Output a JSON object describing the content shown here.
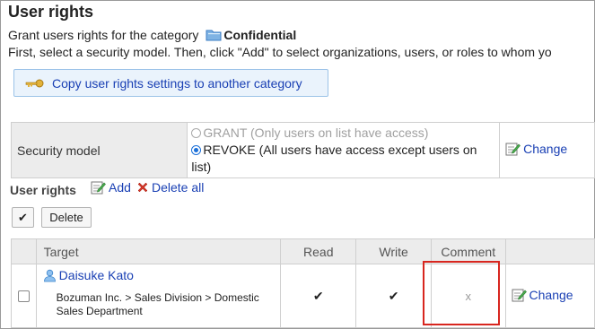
{
  "page": {
    "title": "User rights",
    "grant_prefix": "Grant users rights for the category",
    "category_name": "Confidential",
    "instruction": "First, select a security model. Then, click \"Add\" to select organizations, users, or roles to whom yo"
  },
  "copy_button": {
    "label": "Copy user rights settings to another category"
  },
  "security": {
    "label": "Security model",
    "option_grant": "GRANT (Only users on list have access)",
    "option_revoke": "REVOKE (All users have access except users on list)",
    "selected": "REVOKE",
    "change_label": "Change"
  },
  "rights": {
    "heading": "User rights",
    "add_label": "Add",
    "delete_all_label": "Delete all",
    "check_button": "✔",
    "delete_button": "Delete",
    "columns": [
      "",
      "Target",
      "Read",
      "Write",
      "Comment",
      ""
    ],
    "rows": [
      {
        "user": "Daisuke Kato",
        "department": "Bozuman Inc. > Sales Division > Domestic Sales Department",
        "read": "✔",
        "write": "✔",
        "comment": "x",
        "change_label": "Change"
      }
    ]
  },
  "colors": {
    "link": "#1a40b4",
    "highlight": "#d8261f",
    "header_bg": "#ececec"
  }
}
